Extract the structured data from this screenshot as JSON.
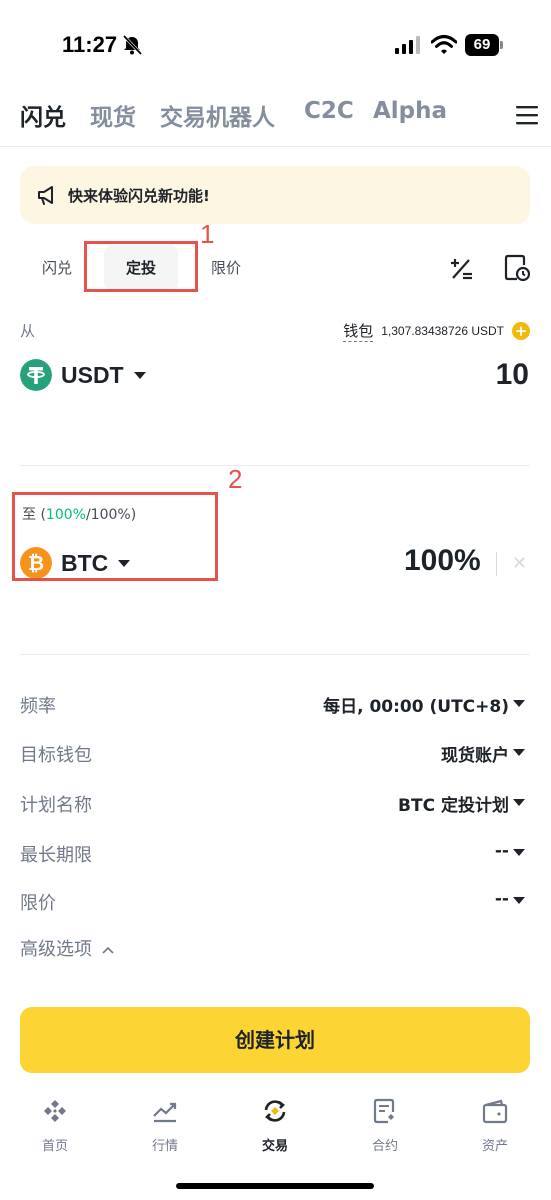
{
  "status_bar": {
    "time": "11:27",
    "battery": "69"
  },
  "top_tabs": [
    {
      "label": "闪兑",
      "active": true
    },
    {
      "label": "现货"
    },
    {
      "label": "交易机器人"
    },
    {
      "label": "C2C"
    },
    {
      "label": "Alpha"
    }
  ],
  "banner": {
    "text": "快来体验闪兑新功能!"
  },
  "sub_tabs": [
    {
      "label": "闪兑"
    },
    {
      "label": "定投",
      "active": true
    },
    {
      "label": "限价"
    }
  ],
  "annotations": {
    "box1": "1",
    "box2": "2"
  },
  "from": {
    "label": "从",
    "wallet_label": "钱包",
    "wallet_amount": "1,307.83438726 USDT",
    "coin": "USDT",
    "amount": "10"
  },
  "to": {
    "label_prefix": "至 (",
    "label_pct": "100%",
    "label_suffix": "/100%)",
    "coin": "BTC",
    "amount": "100%",
    "clear": "✕"
  },
  "settings": [
    {
      "label": "频率",
      "value": "每日, 00:00 (UTC+8)"
    },
    {
      "label": "目标钱包",
      "value": "现货账户"
    },
    {
      "label": "计划名称",
      "value": "BTC 定投计划"
    },
    {
      "label": "最长期限",
      "value": "--"
    },
    {
      "label": "限价",
      "value": "--"
    }
  ],
  "advanced_label": "高级选项",
  "create_button": "创建计划",
  "bottom_nav": [
    {
      "label": "首页",
      "icon": "home-icon"
    },
    {
      "label": "行情",
      "icon": "markets-icon"
    },
    {
      "label": "交易",
      "icon": "trade-icon",
      "active": true
    },
    {
      "label": "合约",
      "icon": "futures-icon"
    },
    {
      "label": "资产",
      "icon": "assets-icon"
    }
  ],
  "colors": {
    "accent": "#FCD535",
    "usdt": "#26A17B",
    "btc": "#F7931A",
    "positive": "#02C076",
    "annotation": "#E5534B"
  }
}
